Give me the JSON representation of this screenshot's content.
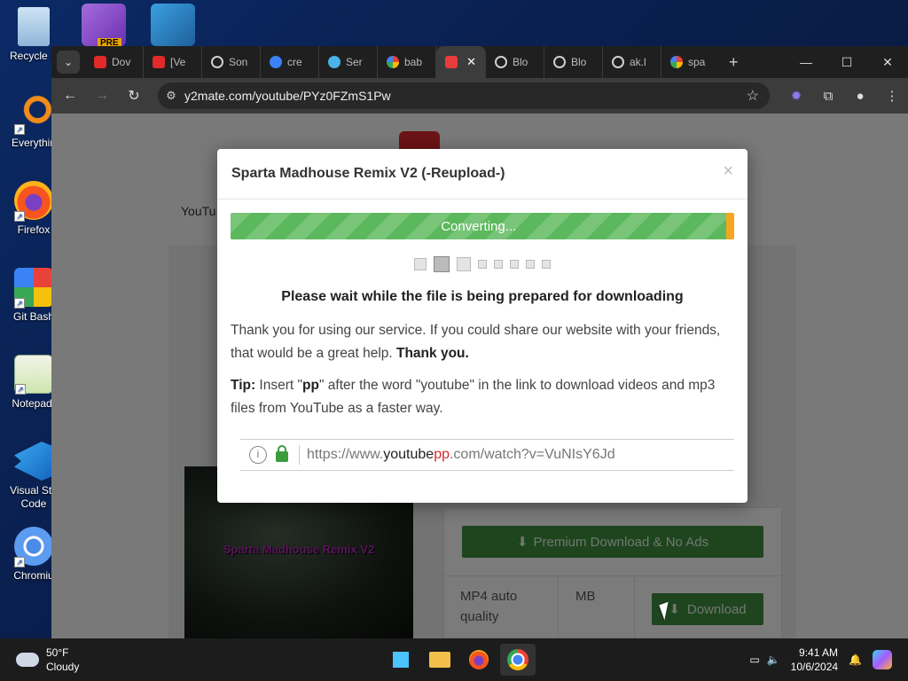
{
  "desktop": {
    "icons": [
      {
        "label": "Recycle B",
        "icon": "recycle-bin-icon"
      },
      {
        "label": "Everythin",
        "icon": "everything-search-icon"
      },
      {
        "label": "Firefox",
        "icon": "firefox-icon"
      },
      {
        "label": "Git Bash",
        "icon": "git-bash-icon"
      },
      {
        "label": "Notepad-",
        "icon": "notepad-plus-icon"
      },
      {
        "label": "Visual Stu Code",
        "icon": "vscode-icon"
      },
      {
        "label": "Chromiu",
        "icon": "chromium-icon"
      }
    ],
    "top_badge": "PRE"
  },
  "browser": {
    "tabs": [
      {
        "label": "Dov",
        "favicon": "#e22a2a"
      },
      {
        "label": "[Ve",
        "favicon": "#e22a2a"
      },
      {
        "label": "Son",
        "favicon": "#cfcfcf"
      },
      {
        "label": "cre",
        "favicon": "#3b82f6"
      },
      {
        "label": "Ser",
        "favicon": "#4ab3e8"
      },
      {
        "label": "bab",
        "favicon": "#ffffff"
      },
      {
        "label": "",
        "favicon": "#e83b3b",
        "active": true
      },
      {
        "label": "Blo",
        "favicon": "#cfcfcf"
      },
      {
        "label": "Blo",
        "favicon": "#cfcfcf"
      },
      {
        "label": "ak.l",
        "favicon": "#cfcfcf"
      },
      {
        "label": "spa",
        "favicon": "#ffffff"
      }
    ],
    "url": "y2mate.com/youtube/PYz0FZmS1Pw",
    "window_controls": [
      "—",
      "☐",
      "✕"
    ]
  },
  "page": {
    "partial_nav": "YouTu",
    "thumbnail_title": "Sparta Madhouse Remix V2",
    "premium_label": "Premium Download & No Ads",
    "format_label": "MP4 auto quality",
    "size_label": "MB",
    "download_label": "Download"
  },
  "modal": {
    "title": "Sparta Madhouse Remix V2 (-Reupload-)",
    "close": "×",
    "progress_label": "Converting...",
    "progress_fraction": 0.985,
    "heading": "Please wait while the file is being prepared for downloading",
    "thanks_text": "Thank you for using our service. If you could share our website with your friends, that would be a great help.",
    "thanks_bold": "Thank you.",
    "tip_label": "Tip:",
    "tip_pre": " Insert \"",
    "tip_pp": "pp",
    "tip_post": "\" after the word \"youtube\" in the link to download videos and mp3 files from YouTube as a faster way.",
    "example_url": {
      "prefix": "https://www.",
      "youtube": "youtube",
      "pp": "pp",
      "suffix": ".com/watch?v=VuNIsY6Jd"
    }
  },
  "taskbar": {
    "weather_temp": "50°F",
    "weather_desc": "Cloudy",
    "time": "9:41 AM",
    "date": "10/6/2024"
  },
  "colors": {
    "accent_green": "#5cb85c",
    "progress_tail": "#f5a623",
    "url_pp_red": "#d9262b"
  }
}
